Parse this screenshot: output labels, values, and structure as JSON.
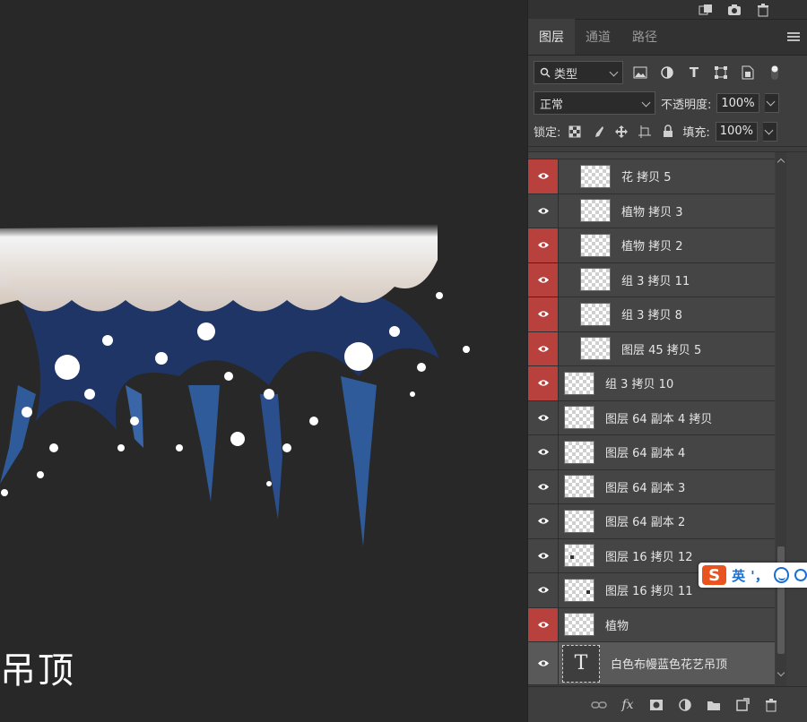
{
  "canvas": {
    "title_text": "吊顶"
  },
  "top_strip": {
    "icons": [
      "new-artboard-icon",
      "camera-icon",
      "trash-icon"
    ]
  },
  "tabs": [
    {
      "label": "图层",
      "active": true
    },
    {
      "label": "通道",
      "active": false
    },
    {
      "label": "路径",
      "active": false
    }
  ],
  "filter": {
    "kind_label": "类型",
    "icons": [
      "image-filter-icon",
      "adjustment-filter-icon",
      "type-filter-icon",
      "shape-filter-icon",
      "smart-object-filter-icon",
      "filter-toggle-icon"
    ]
  },
  "blend": {
    "mode": "正常",
    "opacity_label": "不透明度:",
    "opacity_value": "100%"
  },
  "lock": {
    "label": "锁定:",
    "icons": [
      "lock-transparent-icon",
      "lock-paint-icon",
      "lock-move-icon",
      "lock-artboard-icon",
      "lock-all-icon"
    ],
    "fill_label": "填充:",
    "fill_value": "100%"
  },
  "layers": [
    {
      "name": "花 拷贝 5",
      "visible_red": true,
      "indent": 1
    },
    {
      "name": "植物 拷贝 3",
      "visible_red": false,
      "indent": 1
    },
    {
      "name": "植物 拷贝 2",
      "visible_red": true,
      "indent": 1
    },
    {
      "name": "组 3 拷贝 11",
      "visible_red": true,
      "indent": 1
    },
    {
      "name": "组 3 拷贝 8",
      "visible_red": true,
      "indent": 1
    },
    {
      "name": "图层 45 拷贝 5",
      "visible_red": true,
      "indent": 1
    },
    {
      "name": "组 3 拷贝 10",
      "visible_red": true,
      "indent": 0
    },
    {
      "name": "图层 64 副本 4 拷贝",
      "visible_red": false,
      "indent": 0
    },
    {
      "name": "图层 64 副本 4",
      "visible_red": false,
      "indent": 0
    },
    {
      "name": "图层 64 副本 3",
      "visible_red": false,
      "indent": 0
    },
    {
      "name": "图层 64 副本 2",
      "visible_red": false,
      "indent": 0
    },
    {
      "name": "图层 16 拷贝 12",
      "visible_red": false,
      "indent": 0
    },
    {
      "name": "图层 16 拷贝 11",
      "visible_red": false,
      "indent": 0
    },
    {
      "name": "植物",
      "visible_red": true,
      "indent": 0
    },
    {
      "name": "白色布幔蓝色花艺吊顶",
      "visible_red": false,
      "indent": 0,
      "type": "text",
      "selected": true
    }
  ],
  "bottom_bar": {
    "icons": [
      "link-layers-icon",
      "fx-icon",
      "layer-mask-icon",
      "adjustment-layer-icon",
      "group-folder-icon",
      "new-layer-icon",
      "delete-layer-icon"
    ],
    "fx_label": "fx"
  },
  "ime": {
    "logo": "S",
    "lang": "英",
    "punct": "'，"
  },
  "colors": {
    "panel_bg": "#3e3e3e",
    "visibility_red": "#b8403d",
    "canvas_bg": "#282828"
  }
}
